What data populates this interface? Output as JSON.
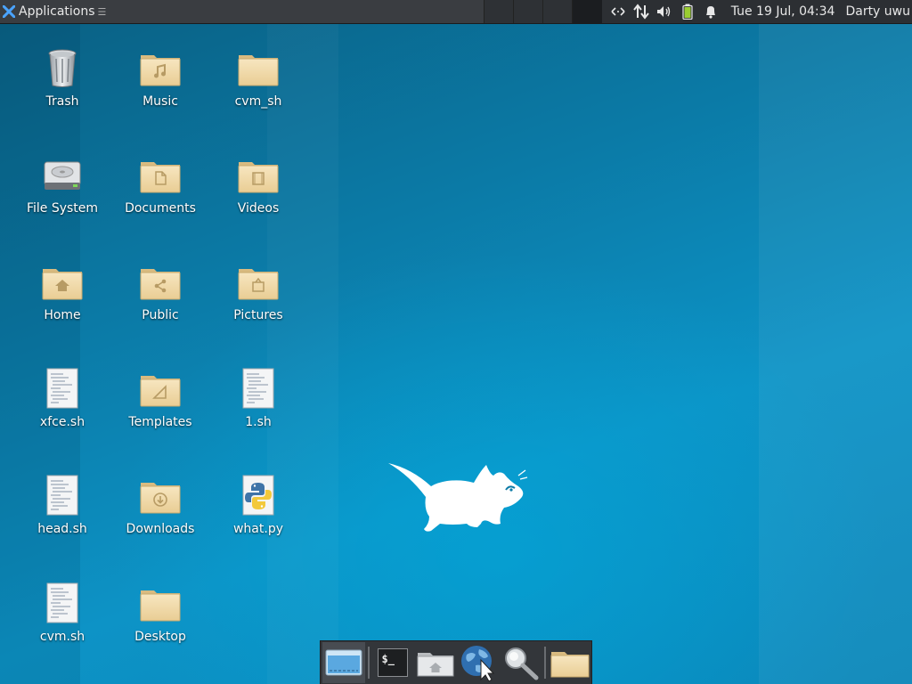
{
  "panel": {
    "app_menu_label": "Applications",
    "clock": "Tue 19 Jul, 04:34",
    "user": "Darty uwu",
    "tray_icons": [
      "network-arrows-icon",
      "transfer-arrows-icon",
      "volume-icon",
      "battery-icon",
      "notification-bell-icon"
    ]
  },
  "desktop": {
    "icons": [
      {
        "label": "Trash",
        "icon": "trash-icon"
      },
      {
        "label": "Music",
        "icon": "music-folder-icon"
      },
      {
        "label": "cvm_sh",
        "icon": "folder-icon"
      },
      {
        "label": "File System",
        "icon": "drive-icon"
      },
      {
        "label": "Documents",
        "icon": "documents-folder-icon"
      },
      {
        "label": "Videos",
        "icon": "videos-folder-icon"
      },
      {
        "label": "Home",
        "icon": "home-folder-icon"
      },
      {
        "label": "Public",
        "icon": "public-folder-icon"
      },
      {
        "label": "Pictures",
        "icon": "pictures-folder-icon"
      },
      {
        "label": "xfce.sh",
        "icon": "script-file-icon"
      },
      {
        "label": "Templates",
        "icon": "templates-folder-icon"
      },
      {
        "label": "1.sh",
        "icon": "script-file-icon"
      },
      {
        "label": "head.sh",
        "icon": "script-file-icon"
      },
      {
        "label": "Downloads",
        "icon": "downloads-folder-icon"
      },
      {
        "label": "what.py",
        "icon": "python-file-icon"
      },
      {
        "label": "cvm.sh",
        "icon": "script-file-icon"
      },
      {
        "label": "Desktop",
        "icon": "folder-icon"
      }
    ]
  },
  "dock": {
    "terminal_prompt": "$_",
    "items": [
      "show-desktop-icon",
      "terminal-icon",
      "home-folder-icon",
      "web-browser-icon",
      "search-icon",
      "file-manager-icon"
    ]
  },
  "colors": {
    "panel": "#2c2f33",
    "desktop_base": "#0b7aa6",
    "folder": "#f0d9a8"
  }
}
